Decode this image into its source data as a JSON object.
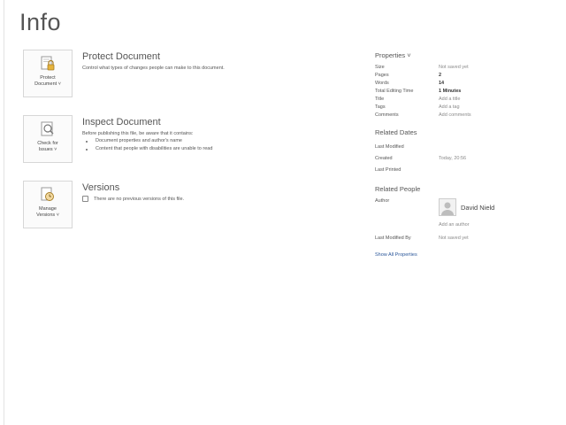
{
  "page": {
    "title": "Info"
  },
  "sections": {
    "protect": {
      "button_label": "Protect\nDocument ˅",
      "heading": "Protect Document",
      "description": "Control what types of changes people can make to this document."
    },
    "inspect": {
      "button_label": "Check for\nIssues ˅",
      "heading": "Inspect Document",
      "description": "Before publishing this file, be aware that it contains:",
      "bullets": [
        "Document properties and author's name",
        "Content that people with disabilities are unable to read"
      ]
    },
    "versions": {
      "button_label": "Manage\nVersions ˅",
      "heading": "Versions",
      "note": "There are no previous versions of this file."
    }
  },
  "properties": {
    "heading": "Properties ˅",
    "rows": [
      {
        "key": "Size",
        "value": "Not saved yet"
      },
      {
        "key": "Pages",
        "value": "2"
      },
      {
        "key": "Words",
        "value": "14"
      },
      {
        "key": "Total Editing Time",
        "value": "1 Minutes"
      },
      {
        "key": "Title",
        "value": "Add a title"
      },
      {
        "key": "Tags",
        "value": "Add a tag"
      },
      {
        "key": "Comments",
        "value": "Add comments"
      }
    ]
  },
  "related_dates": {
    "heading": "Related Dates",
    "rows": [
      {
        "key": "Last Modified",
        "value": ""
      },
      {
        "key": "Created",
        "value": "Today, 20:56"
      },
      {
        "key": "Last Printed",
        "value": ""
      }
    ]
  },
  "related_people": {
    "heading": "Related People",
    "author_label": "Author",
    "author_name": "David Nield",
    "add_author": "Add an author",
    "last_modified_by_label": "Last Modified By",
    "last_modified_by_value": "Not saved yet",
    "show_all": "Show All Properties"
  }
}
